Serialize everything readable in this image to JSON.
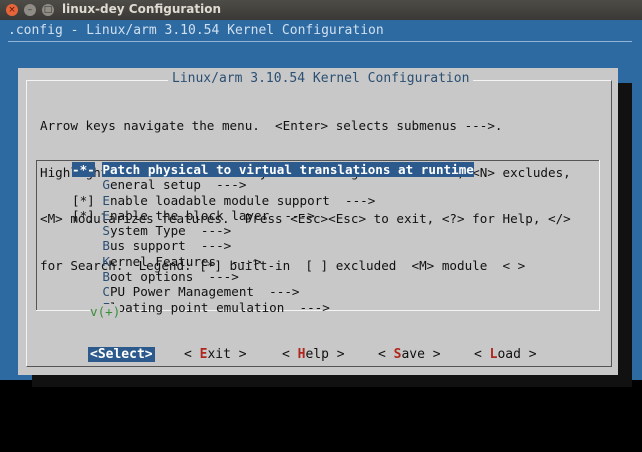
{
  "window": {
    "title": "linux-dey Configuration",
    "close_glyph": "×",
    "min_glyph": "–",
    "max_glyph": "□"
  },
  "background": {
    "title": ".config - Linux/arm 3.10.54 Kernel Configuration"
  },
  "dialog": {
    "title": "Linux/arm 3.10.54 Kernel Configuration",
    "help_lines": [
      "Arrow keys navigate the menu.  <Enter> selects submenus --->.",
      "Highlighted letters are hotkeys.  Pressing <Y> includes, <N> excludes,",
      "<M> modularizes features.  Press <Esc><Esc> to exit, <?> for Help, </>",
      "for Search.  Legend: [*] built-in  [ ] excluded  <M> module  < >"
    ],
    "menu_items": [
      {
        "mark": "-*-",
        "hotkey": "P",
        "rest": "atch physical to virtual translations at runtime",
        "selected": true
      },
      {
        "mark": "   ",
        "hotkey": "G",
        "rest": "eneral setup  --->"
      },
      {
        "mark": "[*]",
        "hotkey": "E",
        "rest": "nable loadable module support  --->"
      },
      {
        "mark": "[*]",
        "hotkey": "E",
        "rest": "nable the block layer  --->"
      },
      {
        "mark": "   ",
        "hotkey": "S",
        "rest": "ystem Type  --->"
      },
      {
        "mark": "   ",
        "hotkey": "B",
        "rest": "us support  --->"
      },
      {
        "mark": "   ",
        "hotkey": "K",
        "rest": "ernel Features  --->"
      },
      {
        "mark": "   ",
        "hotkey": "B",
        "rest": "oot options  --->"
      },
      {
        "mark": "   ",
        "hotkey": "C",
        "rest": "PU Power Management  --->"
      },
      {
        "mark": "   ",
        "hotkey": "F",
        "rest": "loating point emulation  --->"
      }
    ],
    "more_indicator": "v(+)",
    "buttons": {
      "select": {
        "pre": "<",
        "hotkey": "S",
        "post": "elect>"
      },
      "exit": {
        "pre": "< ",
        "hotkey": "E",
        "post": "xit >"
      },
      "help": {
        "pre": "< ",
        "hotkey": "H",
        "post": "elp >"
      },
      "save": {
        "pre": "< ",
        "hotkey": "S",
        "post": "ave >"
      },
      "load": {
        "pre": "< ",
        "hotkey": "L",
        "post": "oad >"
      }
    }
  }
}
